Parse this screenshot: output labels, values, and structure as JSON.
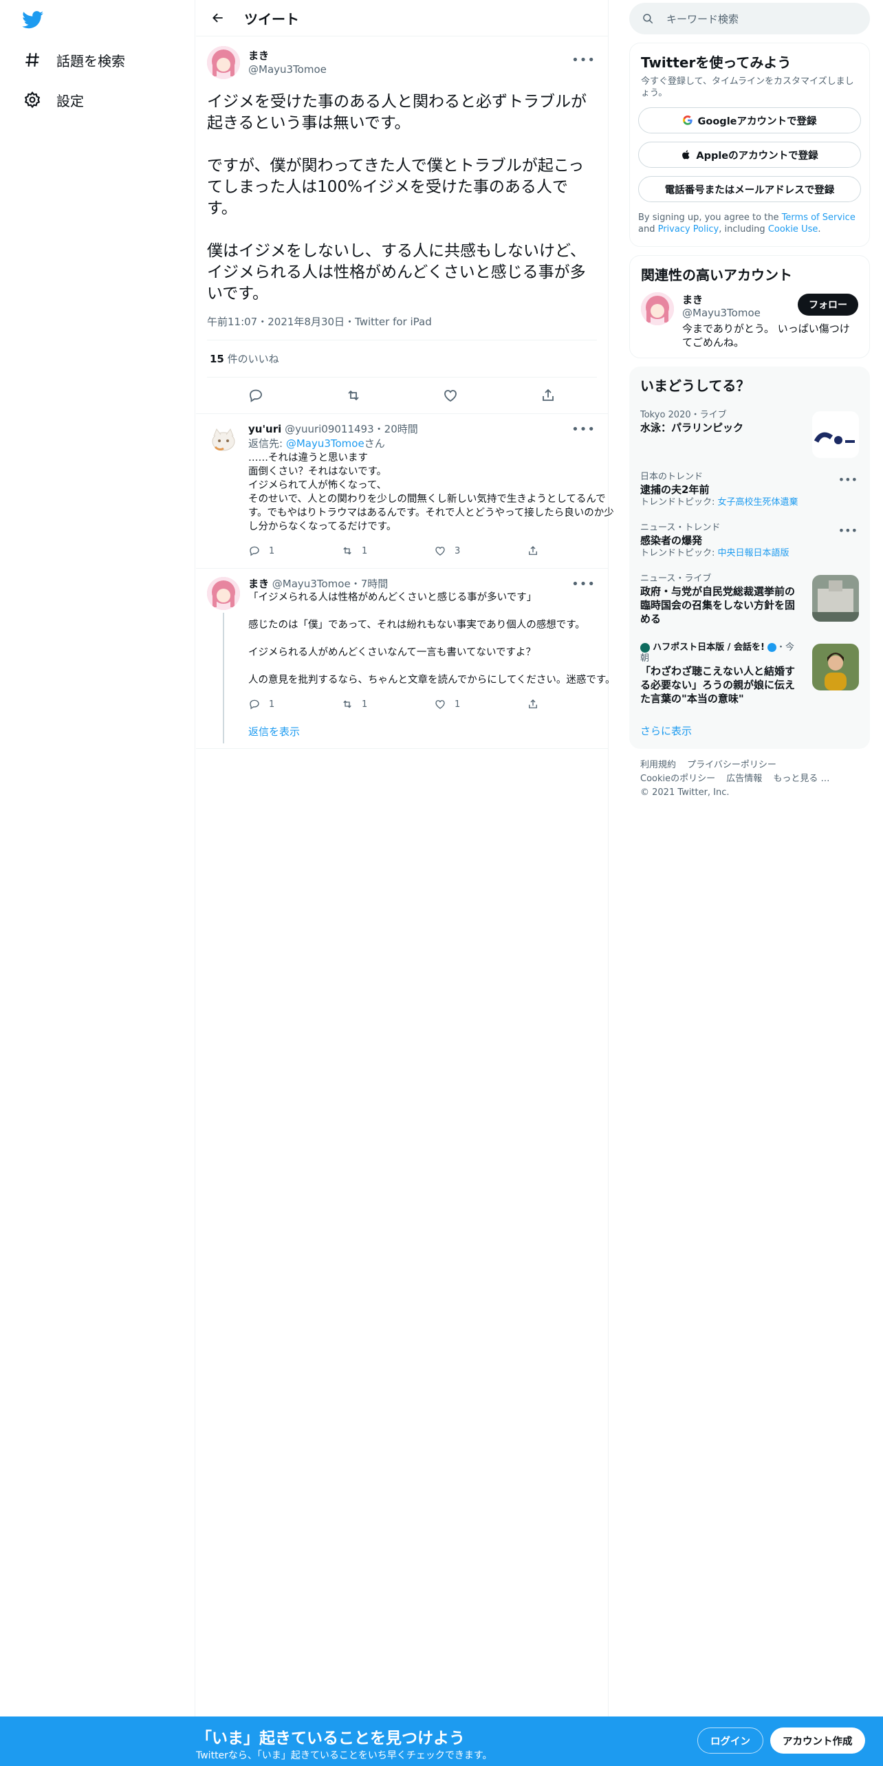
{
  "nav": {
    "items": [
      {
        "label": "話題を検索"
      },
      {
        "label": "設定"
      }
    ]
  },
  "header": {
    "title": "ツイート"
  },
  "focal": {
    "display_name": "まき",
    "username": "@Mayu3Tomoe",
    "text": "イジメを受けた事のある人と関わると必ずトラブルが起きるという事は無いです。\n\nですが、僕が関わってきた人で僕とトラブルが起こってしまった人は100%イジメを受けた事のある人です。\n\n僕はイジメをしないし、する人に共感もしないけど、イジメられる人は性格がめんどくさいと感じる事が多いです。",
    "meta": "午前11:07・2021年8月30日・Twitter for iPad",
    "likes_count": "15",
    "likes_label": " 件のいいね"
  },
  "replies": [
    {
      "display_name": "yu'uri",
      "username": "@yuuri09011493",
      "time": "20時間",
      "reply_to_prefix": "返信先: ",
      "reply_to_user": "@Mayu3Tomoe",
      "reply_to_suffix": "さん",
      "text": "……それは違うと思います\n面倒くさい？それはないです。\nイジメられて人が怖くなって、\nそのせいで、人との関わりを少しの間無くし新しい気持で生きようとしてるんです。でもやはりトラウマはあるんです。それで人とどうやって接したら良いのか少し分からなくなってるだけです。",
      "reply_count": "1",
      "retweet_count": "1",
      "like_count": "3"
    },
    {
      "display_name": "まき",
      "username": "@Mayu3Tomoe",
      "time": "7時間",
      "text": "「イジメられる人は性格がめんどくさいと感じる事が多いです」\n\n感じたのは「僕」であって、それは紛れもない事実であり個人の感想です。\n\nイジメられる人がめんどくさいなんて一言も書いてないですよ？\n\n人の意見を批判するなら、ちゃんと文章を読んでからにしてください。迷惑です。",
      "reply_count": "1",
      "retweet_count": "1",
      "like_count": "1"
    }
  ],
  "show_replies": "返信を表示",
  "search": {
    "placeholder": "キーワード検索"
  },
  "signup": {
    "title": "Twitterを使ってみよう",
    "subtitle": "今すぐ登録して、タイムラインをカスタマイズしましょう。",
    "google": "Googleアカウントで登録",
    "apple": "Appleのアカウントで登録",
    "phone": "電話番号またはメールアドレスで登録",
    "legal_prefix": "By signing up, you agree to the ",
    "terms": "Terms of Service",
    "legal_and": " and ",
    "privacy": "Privacy Policy",
    "legal_including": ", including ",
    "cookie": "Cookie Use",
    "legal_end": "."
  },
  "related": {
    "title": "関連性の高いアカウント",
    "display_name": "まき",
    "username": "@Mayu3Tomoe",
    "follow": "フォロー",
    "bio": "今までありがとう。 いっぱい傷つけてごめんね。"
  },
  "trends": {
    "title": "いまどうしてる？",
    "items": [
      {
        "meta": "Tokyo 2020・ライブ",
        "name": "水泳：パラリンピック"
      },
      {
        "meta": "日本のトレンド",
        "name": "逮捕の夫2年前",
        "sub_prefix": "トレンドトピック: ",
        "sub_link": "女子高校生死体遺棄"
      },
      {
        "meta": "ニュース・トレンド",
        "name": "感染者の爆発",
        "sub_prefix": "トレンドトピック: ",
        "sub_link": "中央日報日本語版"
      },
      {
        "meta": "ニュース・ライブ",
        "name": "政府・与党が自民党総裁選挙前の臨時国会の召集をしない方針を固める"
      },
      {
        "meta_source": "ハフポスト日本版 / 会話を!",
        "meta_time": "・今朝",
        "name": "「わざわざ聴こえない人と結婚する必要ない」ろうの親が娘に伝えた言葉の\"本当の意味\""
      }
    ],
    "show_more": "さらに表示"
  },
  "footer": {
    "links": [
      "利用規約",
      "プライバシーポリシー",
      "Cookieのポリシー",
      "広告情報",
      "もっと見る …"
    ],
    "copyright": "© 2021 Twitter, Inc."
  },
  "banner": {
    "title": "「いま」起きていることを見つけよう",
    "subtitle": "Twitterなら、「いま」起きていることをいち早くチェックできます。",
    "login": "ログイン",
    "signup": "アカウント作成"
  },
  "colors": {
    "accent": "#1d9bf0",
    "text": "#0f1419",
    "muted": "#536471"
  }
}
